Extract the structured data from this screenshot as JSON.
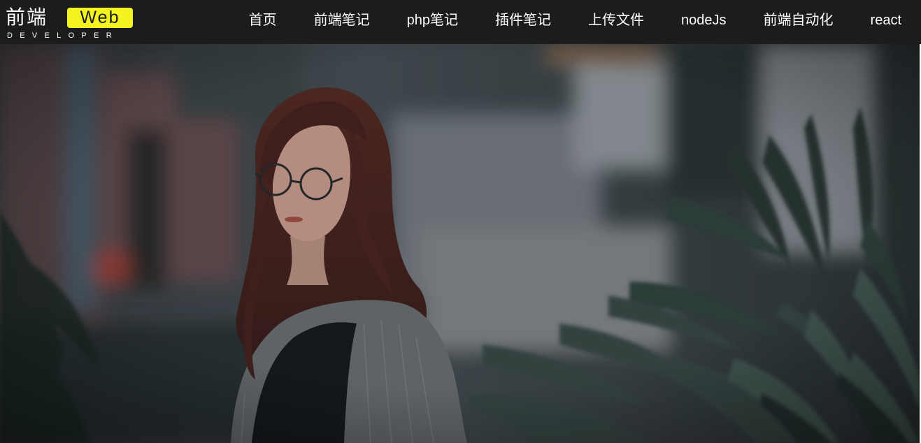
{
  "logo": {
    "cn": "前端",
    "web": "Web",
    "sub": "DEVELOPER"
  },
  "nav": {
    "items": [
      {
        "label": "首页"
      },
      {
        "label": "前端笔记"
      },
      {
        "label": "php笔记"
      },
      {
        "label": "插件笔记"
      },
      {
        "label": "上传文件"
      },
      {
        "label": "nodeJs"
      },
      {
        "label": "前端自动化"
      },
      {
        "label": "react"
      }
    ]
  },
  "colors": {
    "navbar_bg": "#1c1c1c",
    "logo_accent": "#f3f321",
    "nav_text": "#ffffff"
  },
  "hero": {
    "image": "banner-photo-woman-with-glasses"
  }
}
